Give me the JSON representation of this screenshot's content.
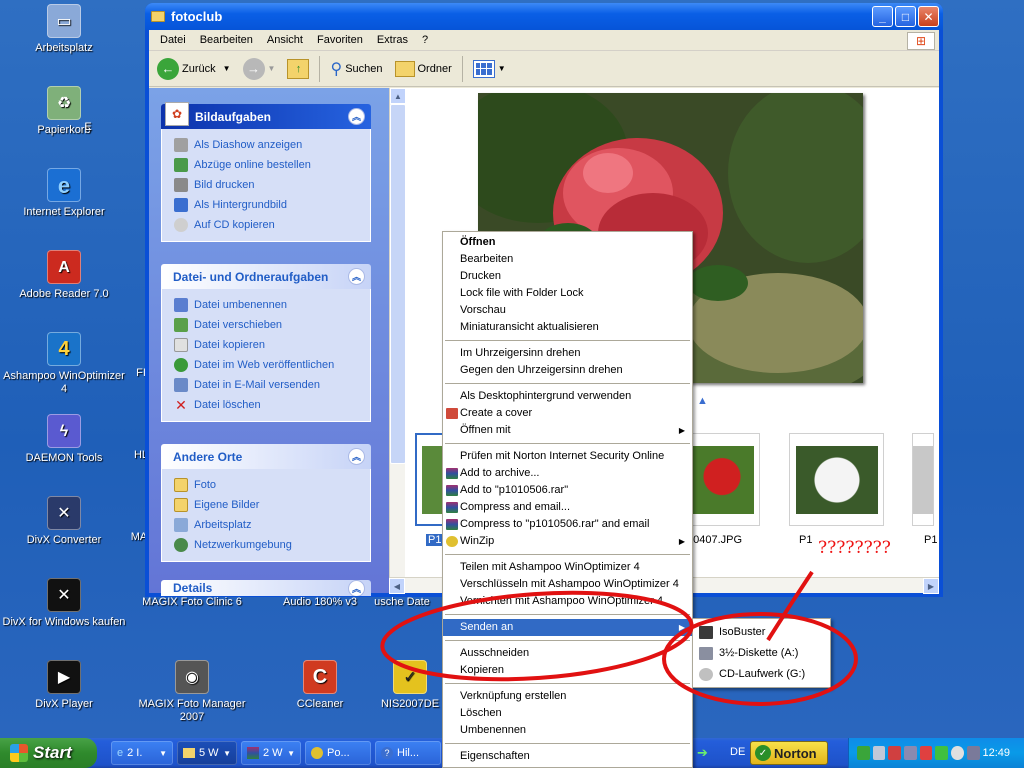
{
  "desktop": {
    "icons": [
      {
        "label": "Arbeitsplatz",
        "icon": "my-computer-icon"
      },
      {
        "label": "Papierkorb",
        "icon": "recycle-bin-icon"
      },
      {
        "label": "Internet Explorer",
        "icon": "internet-explorer-icon"
      },
      {
        "label": "Adobe Reader 7.0",
        "icon": "adobe-reader-icon"
      },
      {
        "label": "Ashampoo WinOptimizer 4",
        "icon": "ashampoo-icon"
      },
      {
        "label": "DAEMON Tools",
        "icon": "daemon-tools-icon"
      },
      {
        "label": "DivX Converter",
        "icon": "divx-converter-icon"
      },
      {
        "label": "DivX for Windows kaufen",
        "icon": "divx-icon"
      },
      {
        "label": "DivX Player",
        "icon": "divx-player-icon"
      },
      {
        "label": "MAGIX Foto Clinic 6",
        "icon": "magix-icon"
      },
      {
        "label": "MAGIX Foto Manager 2007",
        "icon": "camera-icon"
      },
      {
        "label": "Audio 180% v3",
        "icon": "audio-icon"
      },
      {
        "label": "CCleaner",
        "icon": "ccleaner-icon"
      },
      {
        "label": "usche Date",
        "icon": "file-icon"
      },
      {
        "label": "NIS2007DE",
        "icon": "norton-icon"
      }
    ],
    "partial_labels": [
      "E",
      "FI",
      "HL",
      "MA"
    ]
  },
  "window": {
    "title": "fotoclub",
    "menu": [
      "Datei",
      "Bearbeiten",
      "Ansicht",
      "Favoriten",
      "Extras",
      "?"
    ],
    "toolbar": {
      "back": "Zurück",
      "search": "Suchen",
      "folders": "Ordner"
    },
    "panels": [
      {
        "title": "Bildaufgaben",
        "items": [
          "Als Diashow anzeigen",
          "Abzüge online bestellen",
          "Bild drucken",
          "Als Hintergrundbild",
          "Auf CD kopieren"
        ]
      },
      {
        "title": "Datei- und Ordneraufgaben",
        "items": [
          "Datei umbenennen",
          "Datei verschieben",
          "Datei kopieren",
          "Datei im Web veröffentlichen",
          "Datei in E-Mail versenden",
          "Datei löschen"
        ]
      },
      {
        "title": "Andere Orte",
        "items": [
          "Foto",
          "Eigene Bilder",
          "Arbeitsplatz",
          "Netzwerkumgebung"
        ]
      },
      {
        "title": "Details",
        "items": []
      }
    ],
    "thumbnails": [
      {
        "label": "P1"
      },
      {
        "label": "20407.JPG"
      },
      {
        "label": "P1"
      },
      {
        "label": "P1"
      }
    ]
  },
  "context_menu": {
    "groups": [
      [
        "Öffnen",
        "Bearbeiten",
        "Drucken",
        "Lock file with Folder Lock",
        "Vorschau",
        "Miniaturansicht aktualisieren"
      ],
      [
        "Im Uhrzeigersinn drehen",
        "Gegen den Uhrzeigersinn drehen"
      ],
      [
        "Als Desktophintergrund verwenden",
        "Create a cover",
        "Öffnen mit"
      ],
      [
        "Prüfen mit Norton Internet Security Online",
        "Add to archive...",
        "Add to \"p1010506.rar\"",
        "Compress and email...",
        "Compress to \"p1010506.rar\" and email",
        "WinZip"
      ],
      [
        "Teilen mit Ashampoo WinOptimizer 4",
        "Verschlüsseln mit Ashampoo WinOptimizer 4",
        "Vernichten mit Ashampoo WinOptimizer 4"
      ],
      [
        "Senden an"
      ],
      [
        "Ausschneiden",
        "Kopieren"
      ],
      [
        "Verknüpfung erstellen",
        "Löschen",
        "Umbenennen"
      ],
      [
        "Eigenschaften"
      ]
    ],
    "highlighted": "Senden an"
  },
  "send_to_menu": [
    "IsoBuster",
    "3½-Diskette (A:)",
    "CD-Laufwerk (G:)"
  ],
  "annotation": {
    "question_marks": "????????",
    "color": "#e11111"
  },
  "taskbar": {
    "start": "Start",
    "tasks": [
      "2 I.",
      "5 W",
      "2 W",
      "Po...",
      "Hil..."
    ],
    "language": "DE",
    "norton": "Norton",
    "clock": "12:49"
  }
}
